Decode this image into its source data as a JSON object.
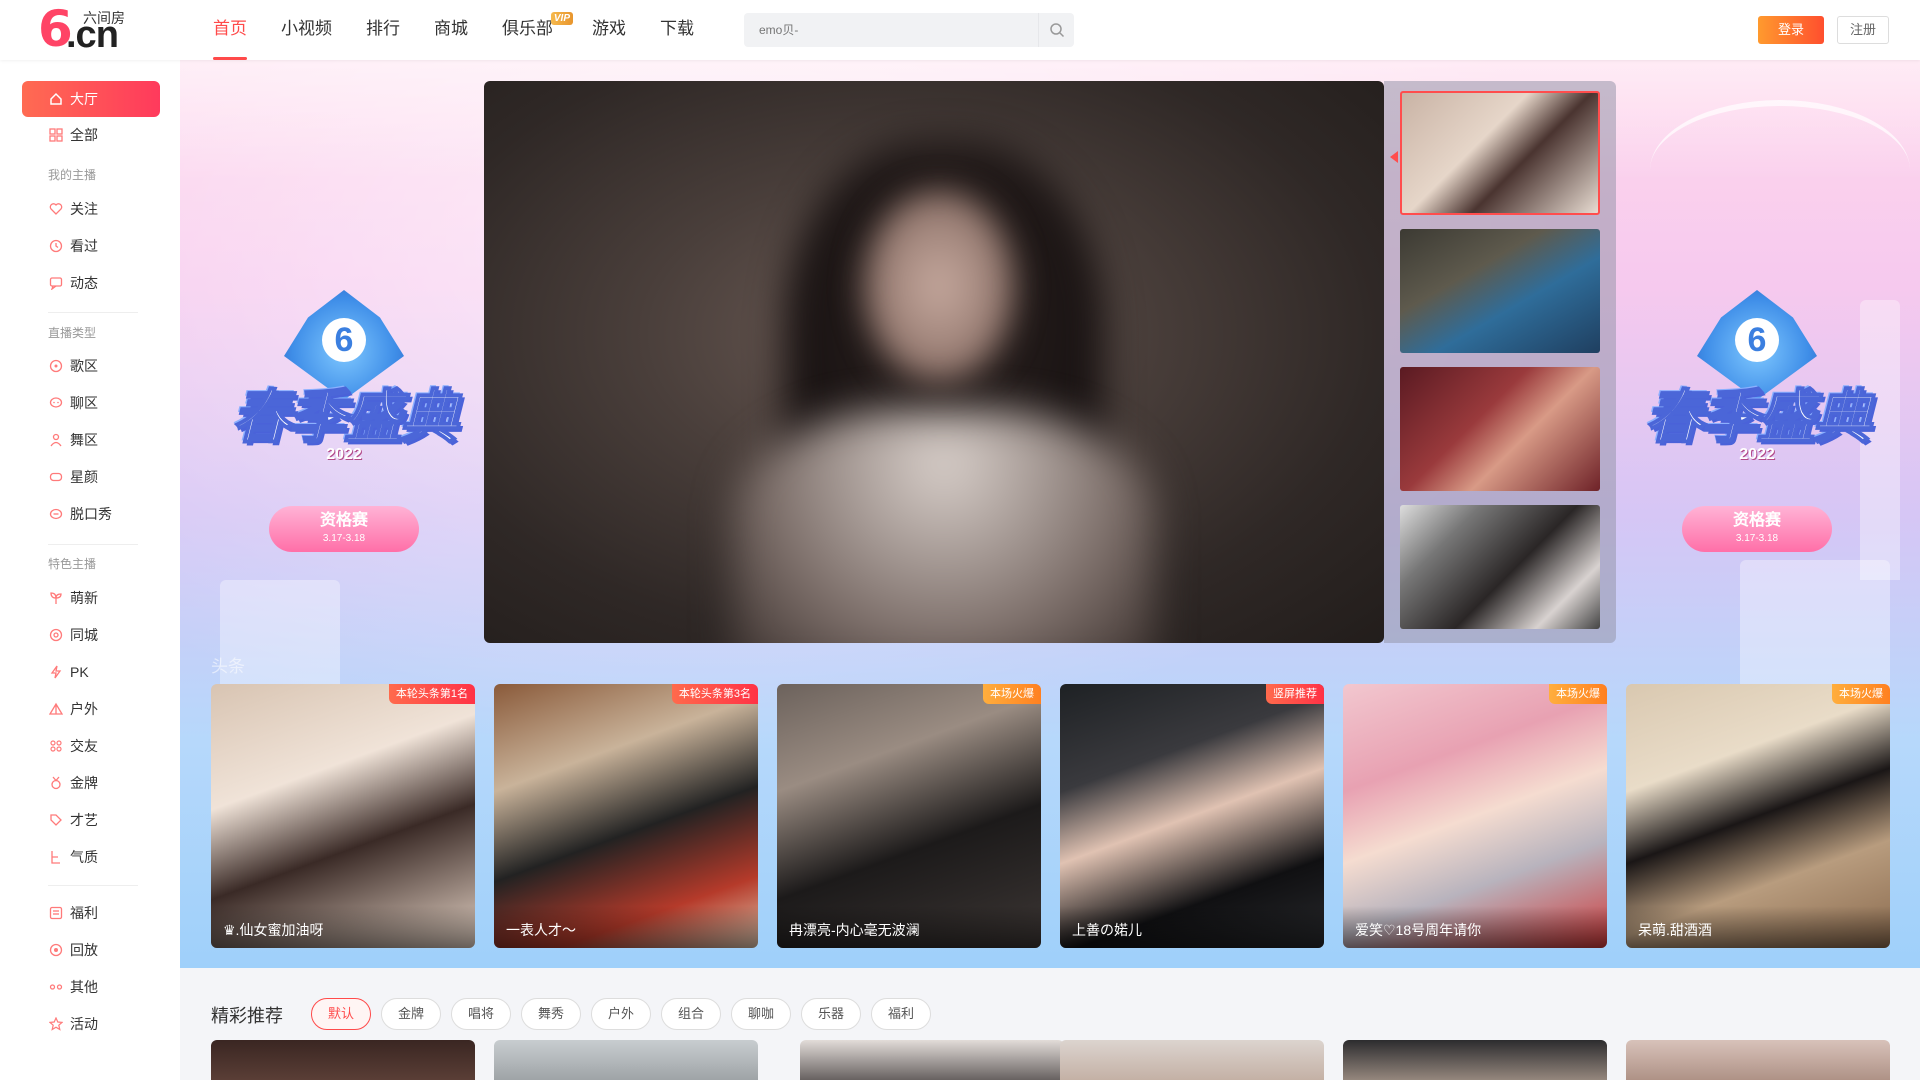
{
  "header": {
    "logo_six": "6",
    "logo_domain": ".cn",
    "logo_name": "六间房",
    "nav": [
      {
        "label": "首页",
        "active": true
      },
      {
        "label": "小视频"
      },
      {
        "label": "排行"
      },
      {
        "label": "商城"
      },
      {
        "label": "俱乐部",
        "badge": "VIP"
      },
      {
        "label": "游戏"
      },
      {
        "label": "下载"
      }
    ],
    "search_placeholder": "emo贝-",
    "login_label": "登录",
    "register_label": "注册"
  },
  "sidebar": {
    "main": [
      {
        "label": "大厅",
        "icon": "home-icon",
        "active": true
      },
      {
        "label": "全部",
        "icon": "grid-icon"
      }
    ],
    "my_title": "我的主播",
    "my": [
      {
        "label": "关注",
        "icon": "heart-icon"
      },
      {
        "label": "看过",
        "icon": "clock-icon"
      },
      {
        "label": "动态",
        "icon": "message-icon"
      }
    ],
    "type_title": "直播类型",
    "types": [
      {
        "label": "歌区",
        "icon": "music-icon"
      },
      {
        "label": "聊区",
        "icon": "chat-icon"
      },
      {
        "label": "舞区",
        "icon": "dance-icon"
      },
      {
        "label": "星颜",
        "icon": "mask-icon"
      },
      {
        "label": "脱口秀",
        "icon": "talk-icon"
      }
    ],
    "feature_title": "特色主播",
    "features": [
      {
        "label": "萌新",
        "icon": "sprout-icon"
      },
      {
        "label": "同城",
        "icon": "location-icon"
      },
      {
        "label": "PK",
        "icon": "lightning-icon"
      },
      {
        "label": "户外",
        "icon": "outdoor-icon"
      },
      {
        "label": "交友",
        "icon": "friends-icon"
      },
      {
        "label": "金牌",
        "icon": "medal-icon"
      },
      {
        "label": "才艺",
        "icon": "talent-icon"
      },
      {
        "label": "气质",
        "icon": "style-icon"
      }
    ],
    "other": [
      {
        "label": "福利",
        "icon": "gift-icon"
      },
      {
        "label": "回放",
        "icon": "replay-icon"
      },
      {
        "label": "其他",
        "icon": "more-icon"
      },
      {
        "label": "活动",
        "icon": "star-icon"
      }
    ]
  },
  "banner": {
    "event_num": "6",
    "event_title": "春季盛典",
    "event_year": "2022",
    "event_stage": "资格赛",
    "event_dates": "3.17-3.18"
  },
  "headline": {
    "section_label": "头条",
    "cards": [
      {
        "tag": "本轮头条第1名",
        "tag_color": "red",
        "name": "♛.仙女蜜加油呀"
      },
      {
        "tag": "本轮头条第3名",
        "tag_color": "red",
        "name": "一表人才～"
      },
      {
        "tag": "本场火爆",
        "tag_color": "orange",
        "name": "冉漂亮-内心毫无波澜"
      },
      {
        "tag": "竖屏推荐",
        "tag_color": "red",
        "name": "上善の婼儿"
      },
      {
        "tag": "本场火爆",
        "tag_color": "orange",
        "name": "爱笑♡18号周年请你"
      },
      {
        "tag": "本场火爆",
        "tag_color": "orange",
        "name": "呆萌.甜酒酒"
      }
    ]
  },
  "recommend": {
    "title": "精彩推荐",
    "filters": [
      "默认",
      "金牌",
      "唱将",
      "舞秀",
      "户外",
      "组合",
      "聊咖",
      "乐器",
      "福利"
    ],
    "active_filter": "默认"
  },
  "colors": {
    "accent": "#ff4a4a",
    "sidebar_active_start": "#ff6b52",
    "sidebar_active_end": "#ff3a5c",
    "login_start": "#ff9a2e",
    "login_end": "#ff4f2e"
  }
}
